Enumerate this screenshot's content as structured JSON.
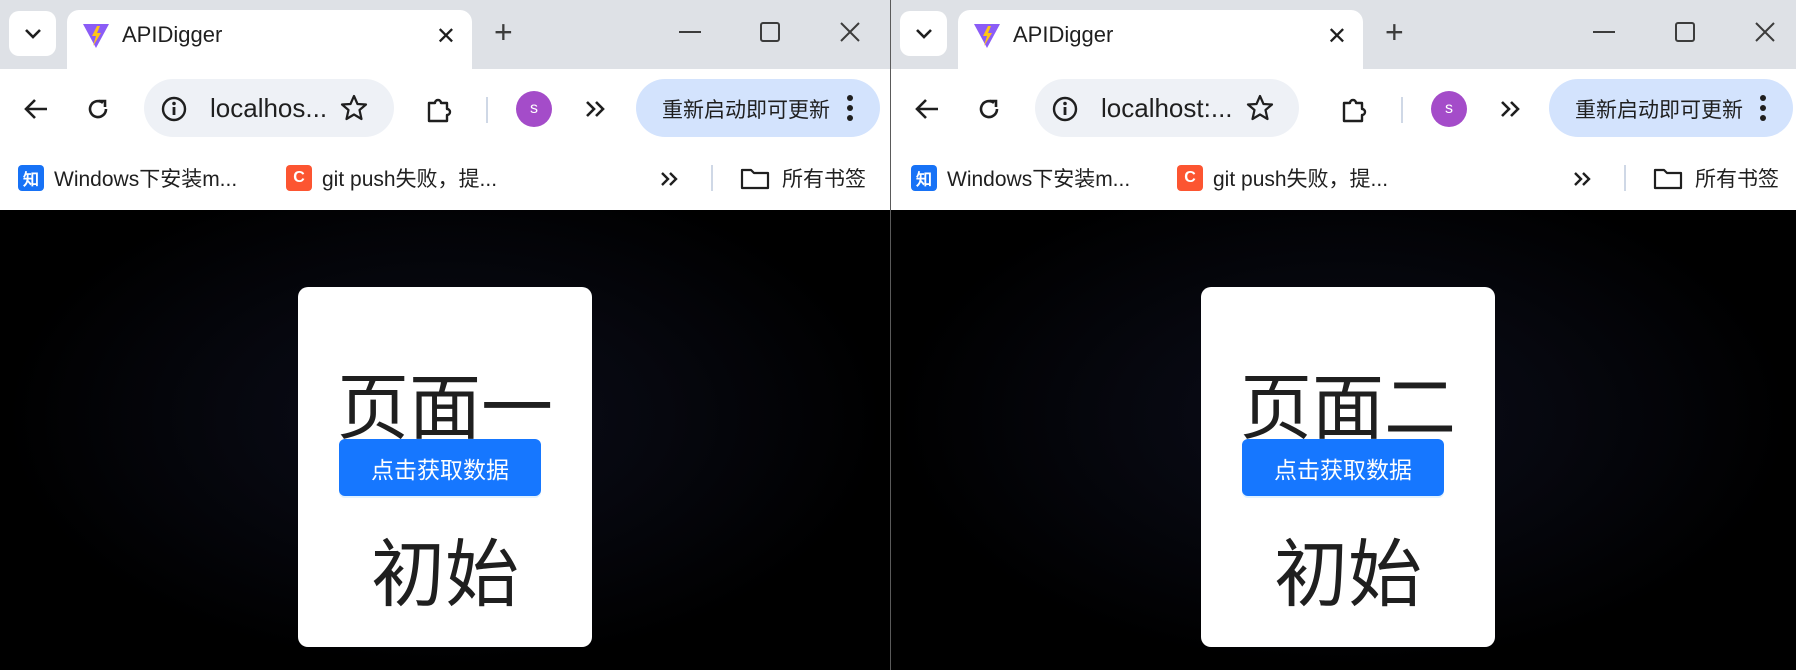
{
  "left": {
    "tab": {
      "title": "APIDigger",
      "close": "✕"
    },
    "toolbar": {
      "url": "localhos...",
      "update_label": "重新启动即可更新",
      "avatar": "s"
    },
    "bookmarks": [
      {
        "label": "Windows下安装m..."
      },
      {
        "label": "git push失败，提..."
      }
    ],
    "all_bookmarks": "所有书签",
    "page": {
      "heading": "页面一",
      "button": "点击获取数据",
      "status": "初始"
    }
  },
  "right": {
    "tab": {
      "title": "APIDigger",
      "close": "✕"
    },
    "toolbar": {
      "url": "localhost:...",
      "update_label": "重新启动即可更新",
      "avatar": "s"
    },
    "bookmarks": [
      {
        "label": "Windows下安装m..."
      },
      {
        "label": "git push失败，提..."
      }
    ],
    "all_bookmarks": "所有书签",
    "page": {
      "heading": "页面二",
      "button": "点击获取数据",
      "status": "初始"
    }
  },
  "common": {
    "new_tab": "+",
    "bookmark_icon_zhihu": "知",
    "bookmark_icon_csdn": "C"
  },
  "colors": {
    "accent": "#1677ff",
    "update_bg": "#d3e3fd",
    "tabbar": "#dee1e6",
    "avatar": "#a44cc9",
    "zhihu": "#1772f6",
    "csdn": "#fc5531"
  }
}
